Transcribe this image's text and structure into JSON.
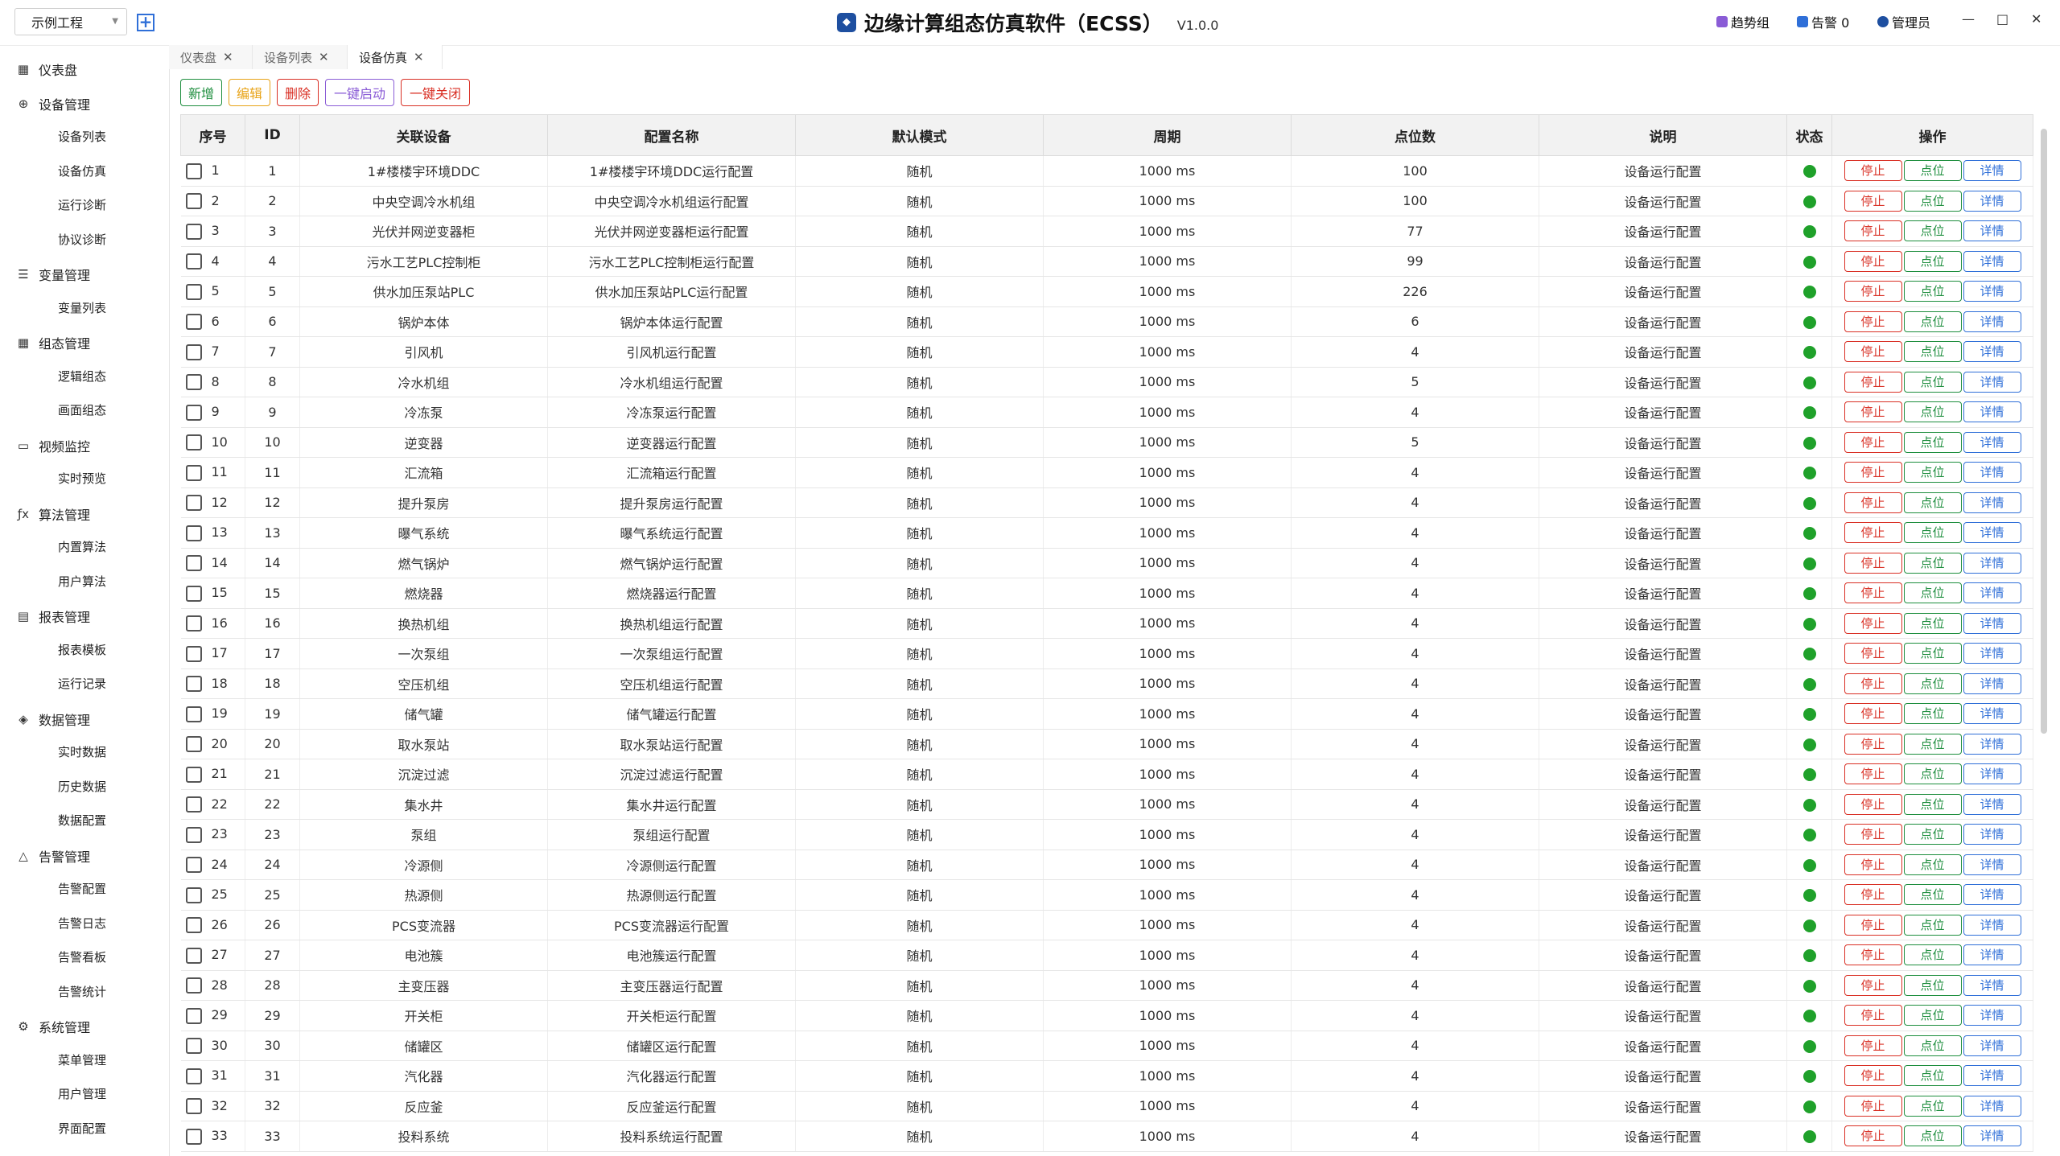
{
  "header": {
    "project": "示例工程",
    "title": "边缘计算组态仿真软件（ECSS）",
    "version": "V1.0.0",
    "trend": "趋势组",
    "alarm": "告警 0",
    "user": "管理员"
  },
  "sidebar": {
    "groups": [
      {
        "label": "仪表盘",
        "icon": "dashboard-icon",
        "glyph": "▦",
        "items": []
      },
      {
        "label": "设备管理",
        "icon": "device-icon",
        "glyph": "⊕",
        "items": [
          "设备列表",
          "设备仿真",
          "运行诊断",
          "协议诊断"
        ]
      },
      {
        "label": "变量管理",
        "icon": "database-icon",
        "glyph": "☰",
        "items": [
          "变量列表"
        ]
      },
      {
        "label": "组态管理",
        "icon": "grid-icon",
        "glyph": "▦",
        "items": [
          "逻辑组态",
          "画面组态"
        ]
      },
      {
        "label": "视频监控",
        "icon": "folder-icon",
        "glyph": "▭",
        "items": [
          "实时预览"
        ]
      },
      {
        "label": "算法管理",
        "icon": "function-icon",
        "glyph": "ƒx",
        "items": [
          "内置算法",
          "用户算法"
        ]
      },
      {
        "label": "报表管理",
        "icon": "report-icon",
        "glyph": "▤",
        "items": [
          "报表模板",
          "运行记录"
        ]
      },
      {
        "label": "数据管理",
        "icon": "layers-icon",
        "glyph": "◈",
        "items": [
          "实时数据",
          "历史数据",
          "数据配置"
        ]
      },
      {
        "label": "告警管理",
        "icon": "bell-icon",
        "glyph": "△",
        "items": [
          "告警配置",
          "告警日志",
          "告警看板",
          "告警统计"
        ]
      },
      {
        "label": "系统管理",
        "icon": "settings-icon",
        "glyph": "⚙",
        "items": [
          "菜单管理",
          "用户管理",
          "界面配置"
        ]
      }
    ]
  },
  "tabs": [
    {
      "label": "仪表盘"
    },
    {
      "label": "设备列表"
    },
    {
      "label": "设备仿真"
    }
  ],
  "toolbar": {
    "add": "新增",
    "edit": "编辑",
    "delete": "删除",
    "start_all": "一键启动",
    "stop_all": "一键关闭"
  },
  "table": {
    "headers": [
      "序号",
      "ID",
      "关联设备",
      "配置名称",
      "默认模式",
      "周期",
      "点位数",
      "说明",
      "状态",
      "操作"
    ],
    "action_labels": {
      "stop": "停止",
      "points": "点位",
      "detail": "详情"
    },
    "rows": [
      {
        "seq": "1",
        "id": "1",
        "device": "1#楼楼宇环境DDC",
        "config": "1#楼楼宇环境DDC运行配置",
        "mode": "随机",
        "period": "1000 ms",
        "points": "100",
        "desc": "设备运行配置"
      },
      {
        "seq": "2",
        "id": "2",
        "device": "中央空调冷水机组",
        "config": "中央空调冷水机组运行配置",
        "mode": "随机",
        "period": "1000 ms",
        "points": "100",
        "desc": "设备运行配置"
      },
      {
        "seq": "3",
        "id": "3",
        "device": "光伏并网逆变器柜",
        "config": "光伏并网逆变器柜运行配置",
        "mode": "随机",
        "period": "1000 ms",
        "points": "77",
        "desc": "设备运行配置"
      },
      {
        "seq": "4",
        "id": "4",
        "device": "污水工艺PLC控制柜",
        "config": "污水工艺PLC控制柜运行配置",
        "mode": "随机",
        "period": "1000 ms",
        "points": "99",
        "desc": "设备运行配置"
      },
      {
        "seq": "5",
        "id": "5",
        "device": "供水加压泵站PLC",
        "config": "供水加压泵站PLC运行配置",
        "mode": "随机",
        "period": "1000 ms",
        "points": "226",
        "desc": "设备运行配置"
      },
      {
        "seq": "6",
        "id": "6",
        "device": "锅炉本体",
        "config": "锅炉本体运行配置",
        "mode": "随机",
        "period": "1000 ms",
        "points": "6",
        "desc": "设备运行配置"
      },
      {
        "seq": "7",
        "id": "7",
        "device": "引风机",
        "config": "引风机运行配置",
        "mode": "随机",
        "period": "1000 ms",
        "points": "4",
        "desc": "设备运行配置"
      },
      {
        "seq": "8",
        "id": "8",
        "device": "冷水机组",
        "config": "冷水机组运行配置",
        "mode": "随机",
        "period": "1000 ms",
        "points": "5",
        "desc": "设备运行配置"
      },
      {
        "seq": "9",
        "id": "9",
        "device": "冷冻泵",
        "config": "冷冻泵运行配置",
        "mode": "随机",
        "period": "1000 ms",
        "points": "4",
        "desc": "设备运行配置"
      },
      {
        "seq": "10",
        "id": "10",
        "device": "逆变器",
        "config": "逆变器运行配置",
        "mode": "随机",
        "period": "1000 ms",
        "points": "5",
        "desc": "设备运行配置"
      },
      {
        "seq": "11",
        "id": "11",
        "device": "汇流箱",
        "config": "汇流箱运行配置",
        "mode": "随机",
        "period": "1000 ms",
        "points": "4",
        "desc": "设备运行配置"
      },
      {
        "seq": "12",
        "id": "12",
        "device": "提升泵房",
        "config": "提升泵房运行配置",
        "mode": "随机",
        "period": "1000 ms",
        "points": "4",
        "desc": "设备运行配置"
      },
      {
        "seq": "13",
        "id": "13",
        "device": "曝气系统",
        "config": "曝气系统运行配置",
        "mode": "随机",
        "period": "1000 ms",
        "points": "4",
        "desc": "设备运行配置"
      },
      {
        "seq": "14",
        "id": "14",
        "device": "燃气锅炉",
        "config": "燃气锅炉运行配置",
        "mode": "随机",
        "period": "1000 ms",
        "points": "4",
        "desc": "设备运行配置"
      },
      {
        "seq": "15",
        "id": "15",
        "device": "燃烧器",
        "config": "燃烧器运行配置",
        "mode": "随机",
        "period": "1000 ms",
        "points": "4",
        "desc": "设备运行配置"
      },
      {
        "seq": "16",
        "id": "16",
        "device": "换热机组",
        "config": "换热机组运行配置",
        "mode": "随机",
        "period": "1000 ms",
        "points": "4",
        "desc": "设备运行配置"
      },
      {
        "seq": "17",
        "id": "17",
        "device": "一次泵组",
        "config": "一次泵组运行配置",
        "mode": "随机",
        "period": "1000 ms",
        "points": "4",
        "desc": "设备运行配置"
      },
      {
        "seq": "18",
        "id": "18",
        "device": "空压机组",
        "config": "空压机组运行配置",
        "mode": "随机",
        "period": "1000 ms",
        "points": "4",
        "desc": "设备运行配置"
      },
      {
        "seq": "19",
        "id": "19",
        "device": "储气罐",
        "config": "储气罐运行配置",
        "mode": "随机",
        "period": "1000 ms",
        "points": "4",
        "desc": "设备运行配置"
      },
      {
        "seq": "20",
        "id": "20",
        "device": "取水泵站",
        "config": "取水泵站运行配置",
        "mode": "随机",
        "period": "1000 ms",
        "points": "4",
        "desc": "设备运行配置"
      },
      {
        "seq": "21",
        "id": "21",
        "device": "沉淀过滤",
        "config": "沉淀过滤运行配置",
        "mode": "随机",
        "period": "1000 ms",
        "points": "4",
        "desc": "设备运行配置"
      },
      {
        "seq": "22",
        "id": "22",
        "device": "集水井",
        "config": "集水井运行配置",
        "mode": "随机",
        "period": "1000 ms",
        "points": "4",
        "desc": "设备运行配置"
      },
      {
        "seq": "23",
        "id": "23",
        "device": "泵组",
        "config": "泵组运行配置",
        "mode": "随机",
        "period": "1000 ms",
        "points": "4",
        "desc": "设备运行配置"
      },
      {
        "seq": "24",
        "id": "24",
        "device": "冷源侧",
        "config": "冷源侧运行配置",
        "mode": "随机",
        "period": "1000 ms",
        "points": "4",
        "desc": "设备运行配置"
      },
      {
        "seq": "25",
        "id": "25",
        "device": "热源侧",
        "config": "热源侧运行配置",
        "mode": "随机",
        "period": "1000 ms",
        "points": "4",
        "desc": "设备运行配置"
      },
      {
        "seq": "26",
        "id": "26",
        "device": "PCS变流器",
        "config": "PCS变流器运行配置",
        "mode": "随机",
        "period": "1000 ms",
        "points": "4",
        "desc": "设备运行配置"
      },
      {
        "seq": "27",
        "id": "27",
        "device": "电池簇",
        "config": "电池簇运行配置",
        "mode": "随机",
        "period": "1000 ms",
        "points": "4",
        "desc": "设备运行配置"
      },
      {
        "seq": "28",
        "id": "28",
        "device": "主变压器",
        "config": "主变压器运行配置",
        "mode": "随机",
        "period": "1000 ms",
        "points": "4",
        "desc": "设备运行配置"
      },
      {
        "seq": "29",
        "id": "29",
        "device": "开关柜",
        "config": "开关柜运行配置",
        "mode": "随机",
        "period": "1000 ms",
        "points": "4",
        "desc": "设备运行配置"
      },
      {
        "seq": "30",
        "id": "30",
        "device": "储罐区",
        "config": "储罐区运行配置",
        "mode": "随机",
        "period": "1000 ms",
        "points": "4",
        "desc": "设备运行配置"
      },
      {
        "seq": "31",
        "id": "31",
        "device": "汽化器",
        "config": "汽化器运行配置",
        "mode": "随机",
        "period": "1000 ms",
        "points": "4",
        "desc": "设备运行配置"
      },
      {
        "seq": "32",
        "id": "32",
        "device": "反应釜",
        "config": "反应釜运行配置",
        "mode": "随机",
        "period": "1000 ms",
        "points": "4",
        "desc": "设备运行配置"
      },
      {
        "seq": "33",
        "id": "33",
        "device": "投料系统",
        "config": "投料系统运行配置",
        "mode": "随机",
        "period": "1000 ms",
        "points": "4",
        "desc": "设备运行配置"
      }
    ]
  },
  "colors": {
    "status_running": "#1fa12a",
    "stop": "#d93025",
    "points": "#1e8e3e",
    "detail": "#2f6fd8",
    "add": "#1e8e3e",
    "edit": "#e8a317",
    "start_all": "#8a5cd6"
  }
}
